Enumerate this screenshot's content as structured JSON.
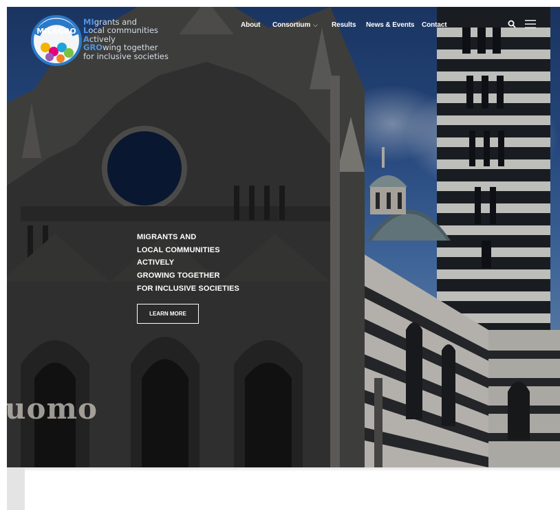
{
  "logo": {
    "line1_accent": "MI",
    "line1_rest": "grants and",
    "line2_accent": "L",
    "line2_rest": "ocal communities",
    "line3_accent": "A",
    "line3_rest": "ctively",
    "line4_accent": "GRO",
    "line4_rest": "wing together",
    "line5": "for inclusive societies",
    "badge_text": "MILAGRO"
  },
  "nav": {
    "items": [
      {
        "label": "About"
      },
      {
        "label": "Consortium",
        "chevron": "⌵"
      },
      {
        "label": "Results"
      },
      {
        "label": "News & Events"
      },
      {
        "label": "Contact"
      }
    ],
    "search_icon": "search-icon",
    "menu_icon": "hamburger-menu-icon"
  },
  "hero": {
    "lines": [
      "MIGRANTS AND",
      "LOCAL COMMUNITIES",
      "ACTIVELY",
      "GROWING TOGETHER",
      "FOR INCLUSIVE SOCIETIES"
    ],
    "cta_label": "LEARN MORE",
    "watermark": "uomo"
  },
  "colors": {
    "accent_blue": "#4d94e3",
    "nav_text": "#ffffff",
    "sky": "#2d5493"
  }
}
